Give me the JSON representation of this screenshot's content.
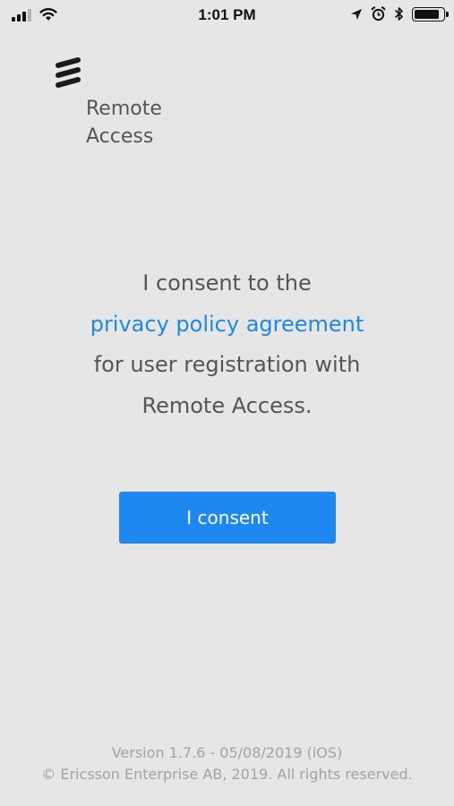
{
  "status_bar": {
    "time": "1:01 PM",
    "signal_bars_filled": 3,
    "signal_bars_total": 4,
    "battery_level_fraction": 0.9,
    "icons": [
      "signal-icon",
      "wifi-icon",
      "location-icon",
      "alarm-icon",
      "bluetooth-icon",
      "battery-icon"
    ]
  },
  "brand": {
    "logo_icon": "ericsson-logo-icon",
    "name_line1": "Remote",
    "name_line2": "Access"
  },
  "consent": {
    "line1": "I consent to the",
    "link_text": "privacy policy agreement",
    "line3": "for user registration with",
    "line4": "Remote Access."
  },
  "button": {
    "label": "I consent"
  },
  "footer": {
    "version": "Version 1.7.6 - 05/08/2019 (iOS)",
    "copyright": "© Ericsson Enterprise AB, 2019.  All rights reserved."
  },
  "colors": {
    "background": "#e6e6e6",
    "link": "#1e88e5",
    "button": "#1e88f0",
    "text": "#555555",
    "footer_text": "#a3a3a3"
  }
}
